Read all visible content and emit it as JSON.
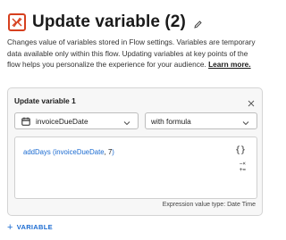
{
  "header": {
    "title": "Update variable (2)",
    "app_icon": "update-variable-icon",
    "edit_icon": "pencil-icon"
  },
  "description": {
    "text": "Changes value of variables stored in Flow settings. Variables are temporary data available only within this flow. Updating variables at key points of the flow helps you personalize the experience for your audience.",
    "link": "Learn more."
  },
  "card": {
    "title": "Update variable 1",
    "variable_select": {
      "value": "invoiceDueDate",
      "icon": "calendar-icon"
    },
    "mode_select": {
      "value": "with formula"
    },
    "expression": {
      "func": "addDays (",
      "arg": "invoiceDueDate",
      "sep": ", ",
      "num": "7",
      "close": ")"
    },
    "expression_type": "Expression value type: Date Time",
    "colors": {
      "accent": "#1b6bd1",
      "brand": "#d6401f"
    }
  },
  "add_button": {
    "plus": "+",
    "label": "VARIABLE"
  }
}
